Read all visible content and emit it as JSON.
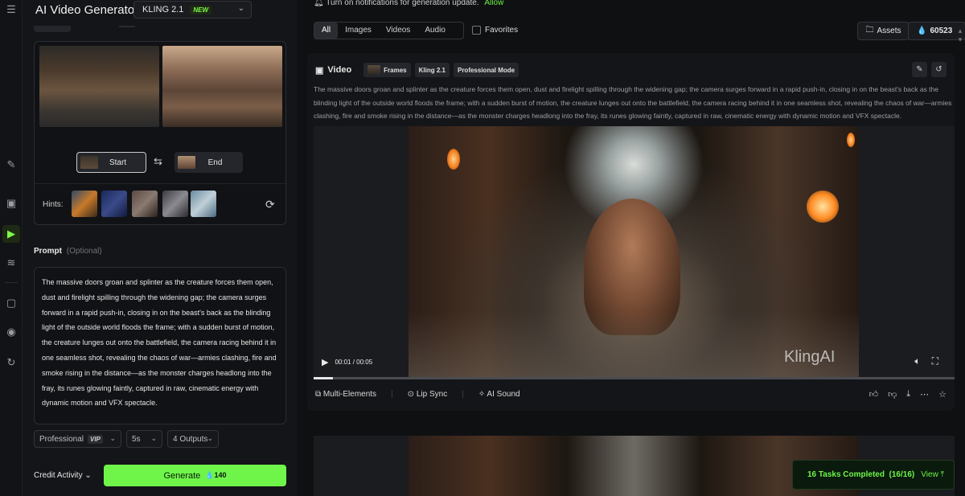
{
  "rail": {
    "icons": [
      "menu-icon",
      "brush-icon",
      "image-icon",
      "video-icon",
      "audio-wave-icon",
      "frame-icon",
      "eye-icon",
      "history-icon"
    ]
  },
  "header": {
    "app_title": "AI Video Generator",
    "model": "KLING 2.1",
    "model_badge": "NEW"
  },
  "frames": {
    "start_label": "Start",
    "end_label": "End",
    "hints_label": "Hints:"
  },
  "prompt": {
    "label": "Prompt",
    "optional": "(Optional)",
    "text": "The massive doors groan and splinter as the creature forces them open, dust and firelight spilling through the widening gap; the camera surges forward in a rapid push-in, closing in on the beast's back as the blinding light of the outside world floods the frame; with a sudden burst of motion, the creature lunges out onto the battlefield, the camera racing behind it in one seamless shot, revealing the chaos of war—armies clashing, fire and smoke rising in the distance—as the monster charges headlong into the fray, its runes glowing faintly, captured in raw, cinematic energy with dynamic motion and VFX spectacle."
  },
  "options": {
    "mode": "Professional",
    "mode_badge": "VIP",
    "duration": "5s",
    "outputs": "4 Outputs"
  },
  "footer": {
    "credit_activity": "Credit Activity",
    "generate_label": "Generate",
    "generate_cost": "140"
  },
  "main": {
    "notification": "Turn on notifications for generation update.",
    "allow": "Allow",
    "filters": [
      "All",
      "Images",
      "Videos",
      "Audio"
    ],
    "active_filter": "All",
    "favorites": "Favorites",
    "assets": "Assets",
    "credits": "60523"
  },
  "video": {
    "heading": "Video",
    "tags": [
      "Frames",
      "Kling 2.1",
      "Professional Mode"
    ],
    "description": "The massive doors groan and splinter as the creature forces them open, dust and firelight spilling through the widening gap; the camera surges forward in a rapid push-in, closing in on the beast's back as the blinding light of the outside world floods the frame; with a sudden burst of motion, the creature lunges out onto the battlefield, the camera racing behind it in one seamless shot, revealing the chaos of war—armies clashing, fire and smoke rising in the distance—as the monster charges headlong into the fray, its runes glowing faintly, captured in raw, cinematic energy with dynamic motion and VFX spectacle.",
    "watermark": "KlingAI",
    "time": "00:01 / 00:05",
    "progress": 0.03,
    "actions": [
      "Multi-Elements",
      "Lip Sync",
      "AI Sound"
    ]
  },
  "toast": {
    "text": "16 Tasks Completed",
    "count": "(16/16)",
    "view": "View"
  }
}
